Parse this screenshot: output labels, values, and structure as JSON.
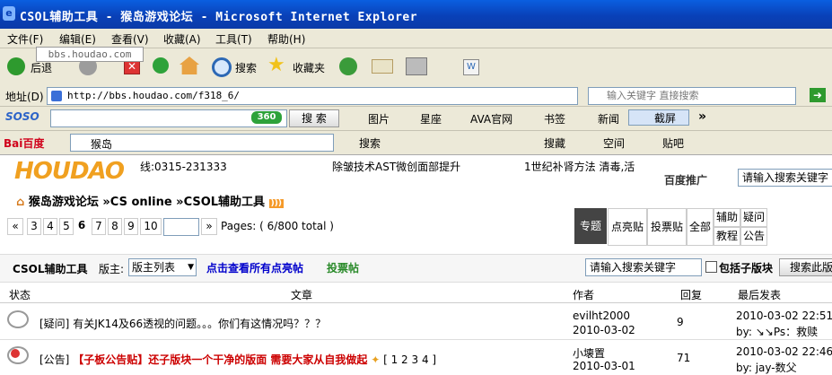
{
  "window": {
    "title": "CSOL辅助工具 - 猴岛游戏论坛 - Microsoft Internet Explorer"
  },
  "menu": [
    "文件(F)",
    "编辑(E)",
    "查看(V)",
    "收藏(A)",
    "工具(T)",
    "帮助(H)"
  ],
  "toolbar": {
    "watermark": "bbs.houdao.com",
    "back": "后退",
    "search": "搜索",
    "favorites": "收藏夹"
  },
  "address": {
    "label": "地址(D)",
    "url": "http://bbs.houdao.com/f318_6/",
    "keyword_placeholder": "输入关键字 直接搜索"
  },
  "soso_bar": {
    "logo": "SOSO",
    "search_btn": "搜 索",
    "items": [
      "图片",
      "星座",
      "AVA官网",
      "书签",
      "新闻",
      "截屏"
    ],
    "more": "»"
  },
  "baidu_bar": {
    "logo": "Bai百度",
    "field_value": "猴岛",
    "search_btn": "搜索",
    "items": [
      "搜藏",
      "空间",
      "贴吧"
    ]
  },
  "page": {
    "logo": "HOUDAO",
    "phone": "线:0315-231333",
    "ad1": "除皱技术AST微创面部提升",
    "ad2": "1世纪补肾方法 清毒,活",
    "baidu_promo": "百度推广",
    "search_placeholder": "请输入搜索关键字",
    "breadcrumb": [
      "猴岛游戏论坛",
      "CS online",
      "CSOL辅助工具"
    ],
    "breadcrumb_sep": "»",
    "pages": [
      "«",
      "3",
      "4",
      "5",
      "6",
      "7",
      "8",
      "9",
      "10",
      "»"
    ],
    "current_page": "6",
    "pages_text": "Pages: ( 6/800 total )",
    "tabs": [
      "专题",
      "点亮贴",
      "投票贴",
      "全部",
      "辅助",
      "疑问",
      "教程",
      "公告"
    ],
    "forum_name": "CSOL辅助工具",
    "moderator_label": "版主:",
    "moderator_select": "版主列表",
    "view_lit": "点击查看所有点亮帖",
    "vote_posts": "投票帖",
    "forum_search_placeholder": "请输入搜索关键字",
    "include_sub": "包括子版块",
    "search_forum_btn": "搜索此版",
    "columns": [
      "状态",
      "文章",
      "作者",
      "回复",
      "最后发表"
    ],
    "rows": [
      {
        "tag": "[疑问]",
        "title": "有关JK14及66透视的问题。。。你们有这情况吗？？？",
        "author": "evilht2000",
        "date": "2010-03-02",
        "replies": "9",
        "last_time": "2010-03-02 22:51",
        "last_by": "by: ↘↘Ps：救赎"
      },
      {
        "tag": "[公告]",
        "title": "【子板公告贴】还子版块一个干净的版面 需要大家从自我做起",
        "pages": "[ 1 2 3 4 ]",
        "author": "小壊置",
        "date": "2010-03-01",
        "replies": "71",
        "last_time": "2010-03-02 22:46",
        "last_by": "by: jay-数父"
      }
    ]
  },
  "colors": {
    "titlebar": "#0941b8",
    "active_tab": "#444444",
    "link_blue": "#0000cc",
    "announce_red": "#cc0000"
  }
}
